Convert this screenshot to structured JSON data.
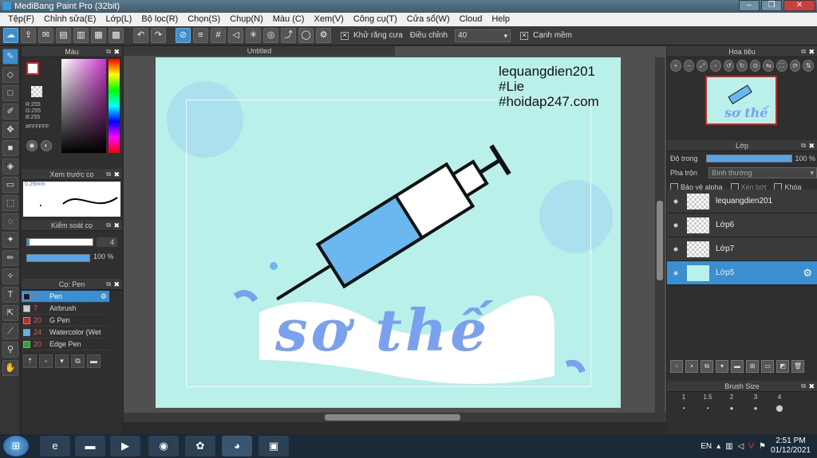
{
  "window": {
    "title": "MediBang Paint Pro (32bit)",
    "buttons": [
      "‒",
      "❐",
      "✕"
    ]
  },
  "menu": [
    "Tệp(F)",
    "Chỉnh sửa(E)",
    "Lớp(L)",
    "Bộ lọc(R)",
    "Chọn(S)",
    "Chụp(N)",
    "Màu (C)",
    "Xem(V)",
    "Công cụ(T)",
    "Cửa sổ(W)",
    "Cloud",
    "Help"
  ],
  "toolbar": {
    "antialias_label": "Khử răng cưa",
    "adjust_label": "Điều chỉnh",
    "adjust_value": "40",
    "sharp_label": "Cạnh mềm"
  },
  "color_panel": {
    "title": "Màu",
    "r": "R:255",
    "g": "G:255",
    "b": "B:255",
    "hex": "#FFFFFF",
    "primary_color": "#ffffff",
    "border_color": "#d42020"
  },
  "brush_preview": {
    "title": "Xem trước cọ",
    "size": "0.29mm"
  },
  "brush_control": {
    "title": "Kiểm soát cọ",
    "size": "4",
    "opacity": "100 %"
  },
  "brush_list": {
    "title": "Cọ: Pen",
    "items": [
      {
        "num": "4",
        "name": "Pen",
        "color": "#1a1a2e"
      },
      {
        "num": "7",
        "name": "Airbrush",
        "color": "#cccccc"
      },
      {
        "num": "20",
        "name": "G Pen",
        "color": "#d42020"
      },
      {
        "num": "24",
        "name": "Watercolor (Wet",
        "color": "#5bb5e8"
      },
      {
        "num": "20",
        "name": "Edge Pen",
        "color": "#22aa22"
      }
    ]
  },
  "canvas": {
    "tab": "Untitled",
    "text_lines": [
      "lequangdien201",
      "#Lie",
      "#hoidap247.com"
    ],
    "background": "#b9f0ea"
  },
  "navigator": {
    "title": "Hoa tiêu",
    "thumb_text": "sơ thế"
  },
  "layer_panel": {
    "title": "Lớp",
    "opacity_label": "Độ trong",
    "opacity_value": "100 %",
    "blend_label": "Pha trộn",
    "blend_value": "Bình thường",
    "protect_alpha": "Bảo vệ alpha",
    "clipping": "Xén bớt",
    "lock": "Khóa",
    "layers": [
      {
        "name": "lequangdien201",
        "selected": false
      },
      {
        "name": "Lớp6",
        "selected": false
      },
      {
        "name": "Lớp7",
        "selected": false
      },
      {
        "name": "Lớp5",
        "selected": true
      }
    ]
  },
  "brush_size": {
    "title": "Brush Size",
    "sizes": [
      "1",
      "1.5",
      "2",
      "3",
      "4"
    ]
  },
  "taskbar": {
    "lang": "EN",
    "time": "2:51 PM",
    "date": "01/12/2021"
  }
}
